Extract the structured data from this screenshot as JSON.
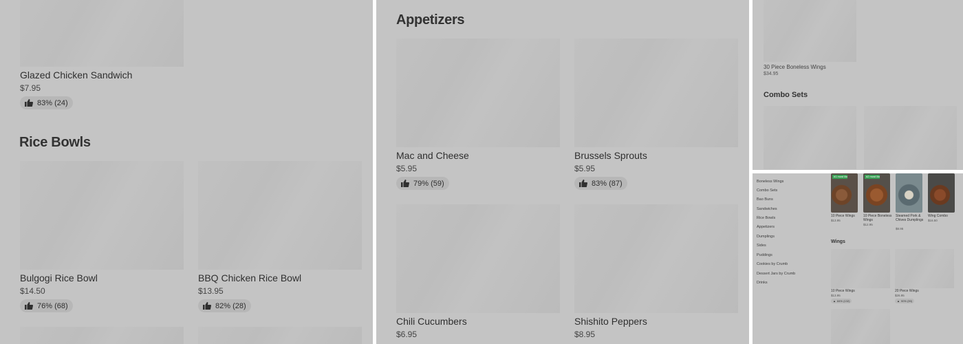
{
  "panel1": {
    "top_item": {
      "name": "Glazed Chicken Sandwich",
      "price": "$7.95",
      "rating": "83% (24)"
    },
    "section_title": "Rice Bowls",
    "items": [
      {
        "name": "Bulgogi Rice Bowl",
        "price": "$14.50",
        "rating": "76% (68)"
      },
      {
        "name": "BBQ Chicken Rice Bowl",
        "price": "$13.95",
        "rating": "82% (28)"
      }
    ]
  },
  "panel2": {
    "section_title": "Appetizers",
    "items": [
      {
        "name": "Mac and Cheese",
        "price": "$5.95",
        "rating": "79% (59)"
      },
      {
        "name": "Brussels Sprouts",
        "price": "$5.95",
        "rating": "83% (87)"
      },
      {
        "name": "Chili Cucumbers",
        "price": "$6.95"
      },
      {
        "name": "Shishito Peppers",
        "price": "$8.95"
      }
    ]
  },
  "panel3": {
    "top_item": {
      "name": "30 Piece Boneless Wings",
      "price": "$34.95"
    },
    "section_title": "Combo Sets"
  },
  "panel4": {
    "nav": [
      "Boneless Wings",
      "Combo Sets",
      "Bao Buns",
      "Sandwiches",
      "Rice Bowls",
      "Appetizers",
      "Dumplings",
      "Sides",
      "Puddings",
      "Cookies by Crumb",
      "Dessert Jars by Crumb",
      "Drinks"
    ],
    "featured": [
      {
        "name": "10 Piece Wings",
        "price": "$13.95",
        "badge": "#1 most liked"
      },
      {
        "name": "10 Piece Boneless Wings",
        "price": "$12.95",
        "badge": "#2 most liked"
      },
      {
        "name": "Steamed Pork & Chives Dumplings",
        "price": "$8.95"
      },
      {
        "name": "Wing Combo",
        "price": "$16.50"
      }
    ],
    "section_title": "Wings",
    "wings": [
      {
        "name": "10 Piece Wings",
        "price": "$13.95",
        "rating": "84% (132)"
      },
      {
        "name": "20 Piece Wings",
        "price": "$26.95",
        "rating": "90% (90)"
      }
    ]
  }
}
